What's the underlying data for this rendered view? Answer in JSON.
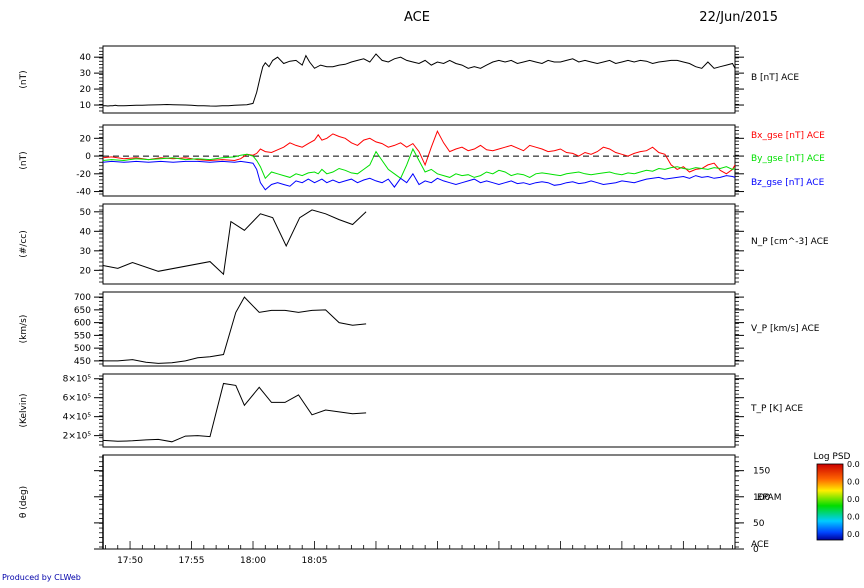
{
  "header": {
    "title": "ACE",
    "date": "22/Jun/2015"
  },
  "footer": {
    "credit": "Produced by CLWeb"
  },
  "colorbar": {
    "title": "Log PSD",
    "labels": [
      "0.0",
      "0.0",
      "0.0",
      "0.0",
      "0.0"
    ]
  },
  "time_axis": {
    "ticks": [
      "17:50",
      "17:55",
      "18:00",
      "18:05"
    ]
  },
  "chart_data": [
    {
      "type": "line",
      "ylabel": "(nT)",
      "ylim": [
        5,
        47
      ],
      "yticks": [
        10,
        20,
        30,
        40
      ],
      "series": [
        {
          "name": "B [nT] ACE",
          "color": "#000000",
          "x": [
            17.8,
            18.0,
            18.2,
            18.4,
            18.6,
            18.8,
            19.0,
            19.5,
            20.0,
            20.5,
            21.0,
            21.5,
            22.0,
            22.5,
            23.0,
            23.5,
            24.0,
            24.5,
            25.0,
            25.5,
            26.0,
            26.5,
            27.0,
            27.5,
            28.0,
            28.5,
            29.0,
            29.5,
            30.0,
            30.3,
            30.6,
            30.8,
            31.0,
            31.3,
            31.6,
            32.0,
            32.5,
            33.0,
            33.5,
            34.0,
            34.3,
            34.6,
            35.0,
            35.5,
            36.0,
            36.5,
            37.0,
            37.5,
            38.0,
            38.5,
            39.0,
            39.5,
            40.0,
            40.5,
            41.0,
            41.5,
            42.0,
            42.5,
            43.0,
            43.5,
            44.0,
            44.5,
            45.0,
            45.5,
            46.0,
            46.5,
            47.0,
            47.5,
            48.0,
            48.5,
            49.0,
            49.5,
            50.0,
            50.5,
            51.0,
            51.5,
            52.0,
            52.5,
            53.0,
            53.5,
            54.0,
            54.5,
            55.0,
            55.5,
            56.0,
            56.5,
            57.0,
            57.5,
            58.0,
            58.5,
            59.0,
            59.5,
            60.0,
            60.5,
            61.0,
            61.5,
            62.0,
            62.5,
            63.0,
            63.5,
            64.0,
            64.5,
            65.0,
            65.5,
            66.0,
            66.5,
            67.0,
            67.5,
            68.0,
            68.5,
            69.0,
            69.2
          ],
          "y": [
            9.5,
            9.6,
            9.4,
            9.5,
            9.6,
            9.8,
            9.5,
            9.6,
            9.7,
            9.8,
            9.9,
            10.0,
            10.1,
            10.2,
            10.3,
            10.2,
            10.1,
            10.0,
            9.8,
            9.5,
            9.6,
            9.4,
            9.3,
            9.5,
            9.6,
            9.8,
            10.0,
            10.2,
            11.0,
            18.0,
            28.0,
            34.0,
            36.5,
            34.0,
            38.0,
            40.0,
            36.0,
            37.5,
            38.0,
            35.0,
            41.0,
            37.0,
            33.0,
            35.0,
            34.0,
            34.0,
            35.0,
            35.5,
            37.0,
            38.0,
            39.0,
            37.0,
            42.0,
            38.0,
            37.0,
            39.0,
            40.0,
            38.0,
            37.0,
            36.0,
            38.0,
            35.0,
            37.0,
            36.0,
            38.0,
            36.0,
            35.0,
            33.0,
            34.0,
            33.0,
            35.0,
            37.0,
            38.0,
            37.0,
            38.0,
            36.0,
            37.0,
            38.0,
            37.0,
            36.0,
            38.0,
            37.0,
            37.0,
            38.0,
            39.0,
            37.0,
            38.0,
            37.0,
            36.0,
            37.0,
            38.0,
            36.0,
            37.0,
            38.0,
            37.0,
            38.0,
            37.5,
            36.0,
            37.0,
            37.5,
            38.0,
            38.0,
            37.0,
            36.0,
            34.0,
            33.0,
            37.0,
            33.0,
            34.0,
            35.0,
            36.0,
            33.0
          ]
        }
      ]
    },
    {
      "type": "line",
      "ylabel": "(nT)",
      "ylim": [
        -45,
        35
      ],
      "yticks": [
        -40,
        -20,
        0,
        20
      ],
      "reference_line": 0,
      "series": [
        {
          "name": "Bx_gse [nT] ACE",
          "color": "#ff0000",
          "x": [
            17.8,
            18.5,
            19.5,
            20.5,
            21.5,
            22.5,
            23.5,
            24.5,
            25.5,
            26.5,
            27.5,
            28.5,
            29.0,
            29.5,
            30.0,
            30.3,
            30.6,
            31.0,
            31.5,
            32.0,
            32.5,
            33.0,
            33.5,
            34.0,
            34.5,
            35.0,
            35.3,
            35.6,
            36.0,
            36.5,
            37.0,
            37.5,
            38.0,
            38.5,
            39.0,
            39.5,
            40.0,
            40.5,
            41.0,
            41.5,
            42.0,
            42.5,
            43.0,
            43.5,
            44.0,
            44.5,
            45.0,
            45.5,
            46.0,
            46.5,
            47.0,
            47.5,
            48.0,
            48.5,
            49.0,
            49.5,
            50.0,
            50.5,
            51.0,
            51.5,
            52.0,
            52.5,
            53.0,
            53.5,
            54.0,
            54.5,
            55.0,
            55.5,
            56.0,
            56.5,
            57.0,
            57.5,
            58.0,
            58.5,
            59.0,
            59.5,
            60.0,
            60.5,
            61.0,
            61.5,
            62.0,
            62.5,
            63.0,
            63.5,
            64.0,
            64.5,
            65.0,
            65.5,
            66.0,
            66.5,
            67.0,
            67.5,
            68.0,
            68.5,
            69.0,
            69.2
          ],
          "y": [
            -2,
            -1,
            -3,
            -2,
            -4,
            -2,
            -3,
            -2,
            -4,
            -5,
            -4,
            -5,
            -3,
            2,
            1,
            3,
            8,
            5,
            4,
            7,
            10,
            15,
            12,
            10,
            14,
            18,
            24,
            18,
            20,
            25,
            22,
            20,
            15,
            12,
            18,
            20,
            16,
            14,
            10,
            12,
            15,
            10,
            14,
            5,
            -10,
            10,
            28,
            15,
            5,
            8,
            10,
            6,
            8,
            12,
            7,
            6,
            8,
            10,
            12,
            9,
            6,
            12,
            10,
            8,
            5,
            6,
            8,
            4,
            3,
            0,
            4,
            2,
            5,
            10,
            8,
            4,
            2,
            0,
            3,
            5,
            6,
            10,
            4,
            2,
            -10,
            -15,
            -12,
            -18,
            -15,
            -14,
            -10,
            -8,
            -16,
            -20,
            -15,
            -10
          ]
        },
        {
          "name": "By_gse [nT] ACE",
          "color": "#00e000",
          "x": [
            17.8,
            18.5,
            19.5,
            20.5,
            21.5,
            22.5,
            23.5,
            24.5,
            25.5,
            26.5,
            27.5,
            28.5,
            29.0,
            29.5,
            30.0,
            30.3,
            30.6,
            31.0,
            31.5,
            32.0,
            32.5,
            33.0,
            33.5,
            34.0,
            34.5,
            35.0,
            35.3,
            35.6,
            36.0,
            36.5,
            37.0,
            37.5,
            38.0,
            38.5,
            39.0,
            39.5,
            40.0,
            40.5,
            41.0,
            41.5,
            42.0,
            42.5,
            43.0,
            43.5,
            44.0,
            44.5,
            45.0,
            45.5,
            46.0,
            46.5,
            47.0,
            47.5,
            48.0,
            48.5,
            49.0,
            49.5,
            50.0,
            50.5,
            51.0,
            51.5,
            52.0,
            52.5,
            53.0,
            53.5,
            54.0,
            54.5,
            55.0,
            55.5,
            56.0,
            56.5,
            57.0,
            57.5,
            58.0,
            58.5,
            59.0,
            59.5,
            60.0,
            60.5,
            61.0,
            61.5,
            62.0,
            62.5,
            63.0,
            63.5,
            64.0,
            64.5,
            65.0,
            65.5,
            66.0,
            66.5,
            67.0,
            67.5,
            68.0,
            68.5,
            69.0,
            69.2
          ],
          "y": [
            -5,
            -4,
            -5,
            -3,
            -4,
            -3,
            -2,
            -4,
            -3,
            -4,
            -2,
            -1,
            1,
            2,
            0,
            -5,
            -12,
            -25,
            -18,
            -20,
            -22,
            -24,
            -20,
            -22,
            -19,
            -18,
            -20,
            -15,
            -20,
            -18,
            -14,
            -16,
            -19,
            -20,
            -15,
            -10,
            5,
            -5,
            -15,
            -20,
            -25,
            -10,
            8,
            -5,
            -18,
            -15,
            -20,
            -22,
            -24,
            -20,
            -22,
            -21,
            -24,
            -22,
            -18,
            -20,
            -16,
            -18,
            -22,
            -20,
            -21,
            -24,
            -20,
            -19,
            -20,
            -21,
            -22,
            -20,
            -19,
            -18,
            -20,
            -21,
            -20,
            -19,
            -18,
            -20,
            -21,
            -19,
            -20,
            -18,
            -16,
            -17,
            -14,
            -15,
            -13,
            -12,
            -14,
            -15,
            -13,
            -14,
            -15,
            -13,
            -14,
            -12,
            -15,
            -14
          ]
        },
        {
          "name": "Bz_gse [nT] ACE",
          "color": "#0000ff",
          "x": [
            17.8,
            18.5,
            19.5,
            20.5,
            21.5,
            22.5,
            23.5,
            24.5,
            25.5,
            26.5,
            27.5,
            28.5,
            29.0,
            29.5,
            30.0,
            30.3,
            30.6,
            31.0,
            31.5,
            32.0,
            32.5,
            33.0,
            33.5,
            34.0,
            34.5,
            35.0,
            35.3,
            35.6,
            36.0,
            36.5,
            37.0,
            37.5,
            38.0,
            38.5,
            39.0,
            39.5,
            40.0,
            40.5,
            41.0,
            41.5,
            42.0,
            42.5,
            43.0,
            43.5,
            44.0,
            44.5,
            45.0,
            45.5,
            46.0,
            46.5,
            47.0,
            47.5,
            48.0,
            48.5,
            49.0,
            49.5,
            50.0,
            50.5,
            51.0,
            51.5,
            52.0,
            52.5,
            53.0,
            53.5,
            54.0,
            54.5,
            55.0,
            55.5,
            56.0,
            56.5,
            57.0,
            57.5,
            58.0,
            58.5,
            59.0,
            59.5,
            60.0,
            60.5,
            61.0,
            61.5,
            62.0,
            62.5,
            63.0,
            63.5,
            64.0,
            64.5,
            65.0,
            65.5,
            66.0,
            66.5,
            67.0,
            67.5,
            68.0,
            68.5,
            69.0,
            69.2
          ],
          "y": [
            -7,
            -6,
            -7,
            -6,
            -7,
            -6,
            -7,
            -6,
            -6,
            -7,
            -6,
            -7,
            -6,
            -7,
            -8,
            -15,
            -30,
            -38,
            -32,
            -30,
            -32,
            -34,
            -28,
            -30,
            -26,
            -30,
            -28,
            -26,
            -30,
            -27,
            -30,
            -28,
            -26,
            -30,
            -27,
            -25,
            -28,
            -30,
            -26,
            -35,
            -25,
            -30,
            -20,
            -32,
            -28,
            -30,
            -25,
            -28,
            -30,
            -32,
            -30,
            -28,
            -26,
            -30,
            -28,
            -30,
            -32,
            -30,
            -28,
            -31,
            -30,
            -32,
            -30,
            -29,
            -30,
            -33,
            -32,
            -30,
            -29,
            -31,
            -30,
            -28,
            -30,
            -32,
            -31,
            -30,
            -28,
            -29,
            -30,
            -28,
            -26,
            -25,
            -24,
            -26,
            -25,
            -24,
            -23,
            -25,
            -22,
            -24,
            -23,
            -25,
            -24,
            -22,
            -23,
            -24
          ]
        }
      ]
    },
    {
      "type": "line",
      "ylabel": "(#/cc)",
      "ylim": [
        13,
        54
      ],
      "yticks": [
        20,
        30,
        40,
        50
      ],
      "series": [
        {
          "name": "N_P [cm^-3] ACE",
          "color": "#000000",
          "x": [
            17.8,
            19.0,
            20.2,
            22.3,
            26.5,
            27.6,
            28.2,
            29.3,
            30.6,
            31.6,
            32.7,
            33.8,
            34.8,
            35.9,
            37.0,
            38.1,
            39.2
          ],
          "y": [
            22.5,
            21.0,
            24.0,
            19.5,
            24.5,
            18.0,
            45.0,
            40.5,
            49.0,
            47.0,
            32.5,
            47.0,
            51.0,
            49.0,
            46.0,
            43.5,
            50.0
          ]
        }
      ]
    },
    {
      "type": "line",
      "ylabel": "(km/s)",
      "ylim": [
        430,
        720
      ],
      "yticks": [
        450,
        500,
        550,
        600,
        650,
        700
      ],
      "series": [
        {
          "name": "V_P [km/s] ACE",
          "color": "#000000",
          "x": [
            17.8,
            19.0,
            20.2,
            21.3,
            22.3,
            23.4,
            24.5,
            25.5,
            26.5,
            27.6,
            28.6,
            29.3,
            30.5,
            31.5,
            32.6,
            33.7,
            34.8,
            35.9,
            37.0,
            38.1,
            39.2
          ],
          "y": [
            450,
            450,
            455,
            445,
            440,
            443,
            450,
            462,
            466,
            475,
            640,
            700,
            640,
            648,
            648,
            640,
            648,
            650,
            600,
            590,
            595
          ]
        }
      ]
    },
    {
      "type": "line",
      "ylabel": "(Kelvin)",
      "ylim": [
        800000,
        8500000
      ],
      "yticks": [
        2000000,
        4000000,
        6000000,
        8000000
      ],
      "ytick_labels": [
        "2×10⁵",
        "4×10⁵",
        "6×10⁵",
        "8×10⁵"
      ],
      "series": [
        {
          "name": "T_P [K] ACE",
          "color": "#000000",
          "x": [
            17.8,
            19.0,
            20.2,
            21.3,
            22.3,
            23.4,
            24.5,
            25.5,
            26.5,
            27.6,
            28.6,
            29.3,
            30.5,
            31.5,
            32.6,
            33.7,
            34.8,
            35.9,
            37.0,
            38.1,
            39.2
          ],
          "y": [
            1500000,
            1400000,
            1450000,
            1550000,
            1600000,
            1350000,
            1950000,
            2000000,
            1900000,
            7500000,
            7300000,
            5200000,
            7100000,
            5500000,
            5500000,
            6300000,
            4200000,
            4700000,
            4500000,
            4300000,
            4400000
          ]
        }
      ]
    },
    {
      "type": "heatmap",
      "ylabel": "θ (deg)",
      "ylim": [
        0,
        180
      ],
      "yticks": [
        0,
        50,
        100,
        150
      ],
      "label": "EPAM",
      "subtitle": "ACE"
    }
  ]
}
